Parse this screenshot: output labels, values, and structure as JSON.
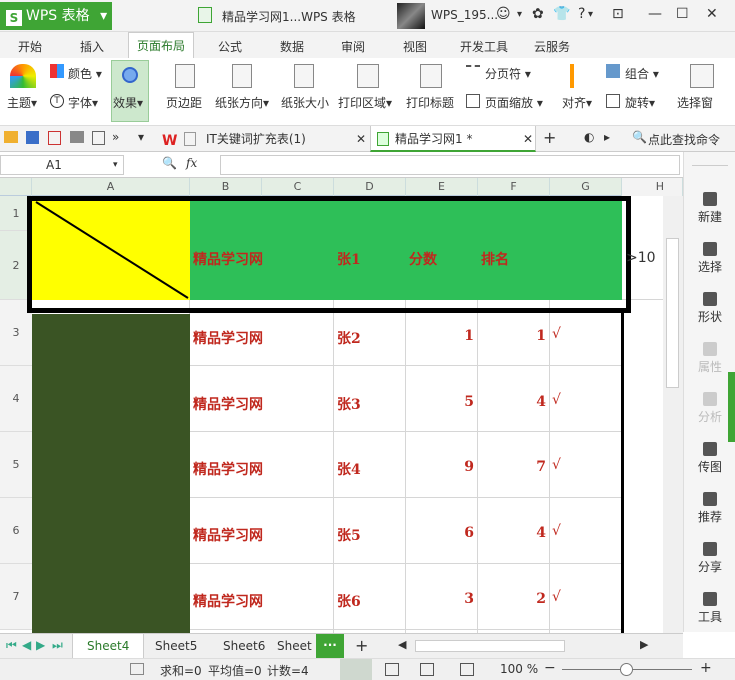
{
  "titlebar": {
    "app": "WPS 表格",
    "document": "精品学习网1...WPS 表格",
    "user": "WPS_195...",
    "help": "?"
  },
  "menu_tabs": [
    "开始",
    "插入",
    "页面布局",
    "公式",
    "数据",
    "审阅",
    "视图",
    "开发工具",
    "云服务"
  ],
  "active_tab": "页面布局",
  "ribbon": {
    "theme": "主题",
    "color": "颜色",
    "font": "字体",
    "effect": "效果",
    "margins": "页边距",
    "orientation": "纸张方向",
    "size": "纸张大小",
    "print_area": "打印区域",
    "print_titles": "打印标题",
    "page_break": "分页符",
    "page_scale": "页面缩放",
    "align": "对齐",
    "group": "组合",
    "rotate": "旋转",
    "selection_pane": "选择窗"
  },
  "doc_tabs": [
    {
      "label": "IT关键词扩充表(1)",
      "active": false
    },
    {
      "label": "精品学习网1 *",
      "active": true
    }
  ],
  "search_command": "点此查找命令",
  "formula": {
    "cell_ref": "A1",
    "fx": "fx",
    "value": ""
  },
  "columns": [
    "A",
    "B",
    "C",
    "D",
    "E",
    "F",
    "G",
    "H"
  ],
  "header_row": {
    "b": "精品学习网",
    "d": "张1",
    "e": "分数",
    "f": "排名",
    "h": ">10"
  },
  "rows": [
    {
      "num": "3",
      "b": "精品学习网",
      "d": "张2",
      "e": "1",
      "f": "1",
      "g": "√"
    },
    {
      "num": "4",
      "b": "精品学习网",
      "d": "张3",
      "e": "5",
      "f": "4",
      "g": "√"
    },
    {
      "num": "5",
      "b": "精品学习网",
      "d": "张4",
      "e": "9",
      "f": "7",
      "g": "√"
    },
    {
      "num": "6",
      "b": "精品学习网",
      "d": "张5",
      "e": "6",
      "f": "4",
      "g": "√"
    },
    {
      "num": "7",
      "b": "精品学习网",
      "d": "张6",
      "e": "3",
      "f": "2",
      "g": "√"
    }
  ],
  "row_header_1": "1",
  "row_header_2": "2",
  "right_panel": [
    {
      "label": "新建",
      "enabled": true
    },
    {
      "label": "选择",
      "enabled": true
    },
    {
      "label": "形状",
      "enabled": true
    },
    {
      "label": "属性",
      "enabled": false
    },
    {
      "label": "分析",
      "enabled": false
    },
    {
      "label": "传图",
      "enabled": true
    },
    {
      "label": "推荐",
      "enabled": true
    },
    {
      "label": "分享",
      "enabled": true
    },
    {
      "label": "工具",
      "enabled": true
    }
  ],
  "sheet_tabs": [
    "Sheet4",
    "Sheet5",
    "Sheet6",
    "Sheet"
  ],
  "active_sheet": "Sheet4",
  "status": {
    "sum": "求和=0",
    "avg": "平均值=0",
    "count": "计数=4",
    "zoom": "100 %"
  },
  "colors": {
    "accent_green": "#3fa535",
    "yellow": "#ffff00",
    "header_green": "#2ebf58",
    "dark_green": "#3a5424",
    "text_red": "#c0281e"
  }
}
